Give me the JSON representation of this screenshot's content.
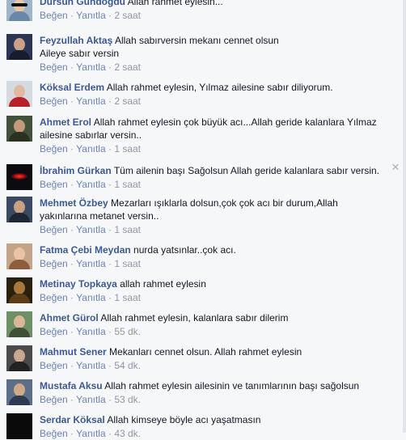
{
  "ui": {
    "like_label": "Beğen",
    "reply_label": "Yanıtla",
    "separator": "·",
    "close_glyph": "×"
  },
  "comments": [
    {
      "author": "Dursun Gündoğdu",
      "text": "Allah rahmet eylesin...",
      "text2": "",
      "time": "2 saat"
    },
    {
      "author": "Feyzullah Aktaş",
      "text": "Allah sabırversin mekanı cennet olsun",
      "text2": "Aileye sabır versin",
      "time": "2 saat"
    },
    {
      "author": "Köksal Erdem",
      "text": "Allah rahmet eylesin, Yılmaz ailesine sabır diliyorum.",
      "text2": "",
      "time": "2 saat"
    },
    {
      "author": "Ahmet Erol",
      "text": "Allah rahmet eylesin çok büyük acı...Allah geride kalanlara Yılmaz",
      "text2": "ailesine sabırlar versin..",
      "time": "1 saat"
    },
    {
      "author": "İbrahim Gürkan",
      "text": "Tüm ailenin başı Sağolsun Allah geride kalanlara sabır versin.",
      "text2": "",
      "time": "1 saat"
    },
    {
      "author": "Mehmet Özbey",
      "text": "Mezarları ışıklarla dolsun,çok çok acı bir durum,Allah",
      "text2": "yakınlarına metanet versin..",
      "time": "1 saat"
    },
    {
      "author": "Fatma Çebi Meydan",
      "text": "nurda yatsınlar..çok acı.",
      "text2": "",
      "time": "1 saat"
    },
    {
      "author": "Metinay Topkaya",
      "text": "allah rahmet eylesin",
      "text2": "",
      "time": "1 saat"
    },
    {
      "author": "Ahmet Gürol",
      "text": "Allah rahmet eylesin, kalanlara sabır dilerim",
      "text2": "",
      "time": "55 dk."
    },
    {
      "author": "Mahmut Sener",
      "text": "Mekanları cennet olsun. Allah rahmet eylesin",
      "text2": "",
      "time": "54 dk."
    },
    {
      "author": "Mustafa Aksu",
      "text": "Allah rahmet eylesin ailesinin ve tanımlarının başı sağolsun",
      "text2": "",
      "time": "53 dk."
    },
    {
      "author": "Serdar Köksal",
      "text": "Allah kimseye böyle acı yaşatmasın",
      "text2": "",
      "time": "43 dk."
    }
  ]
}
